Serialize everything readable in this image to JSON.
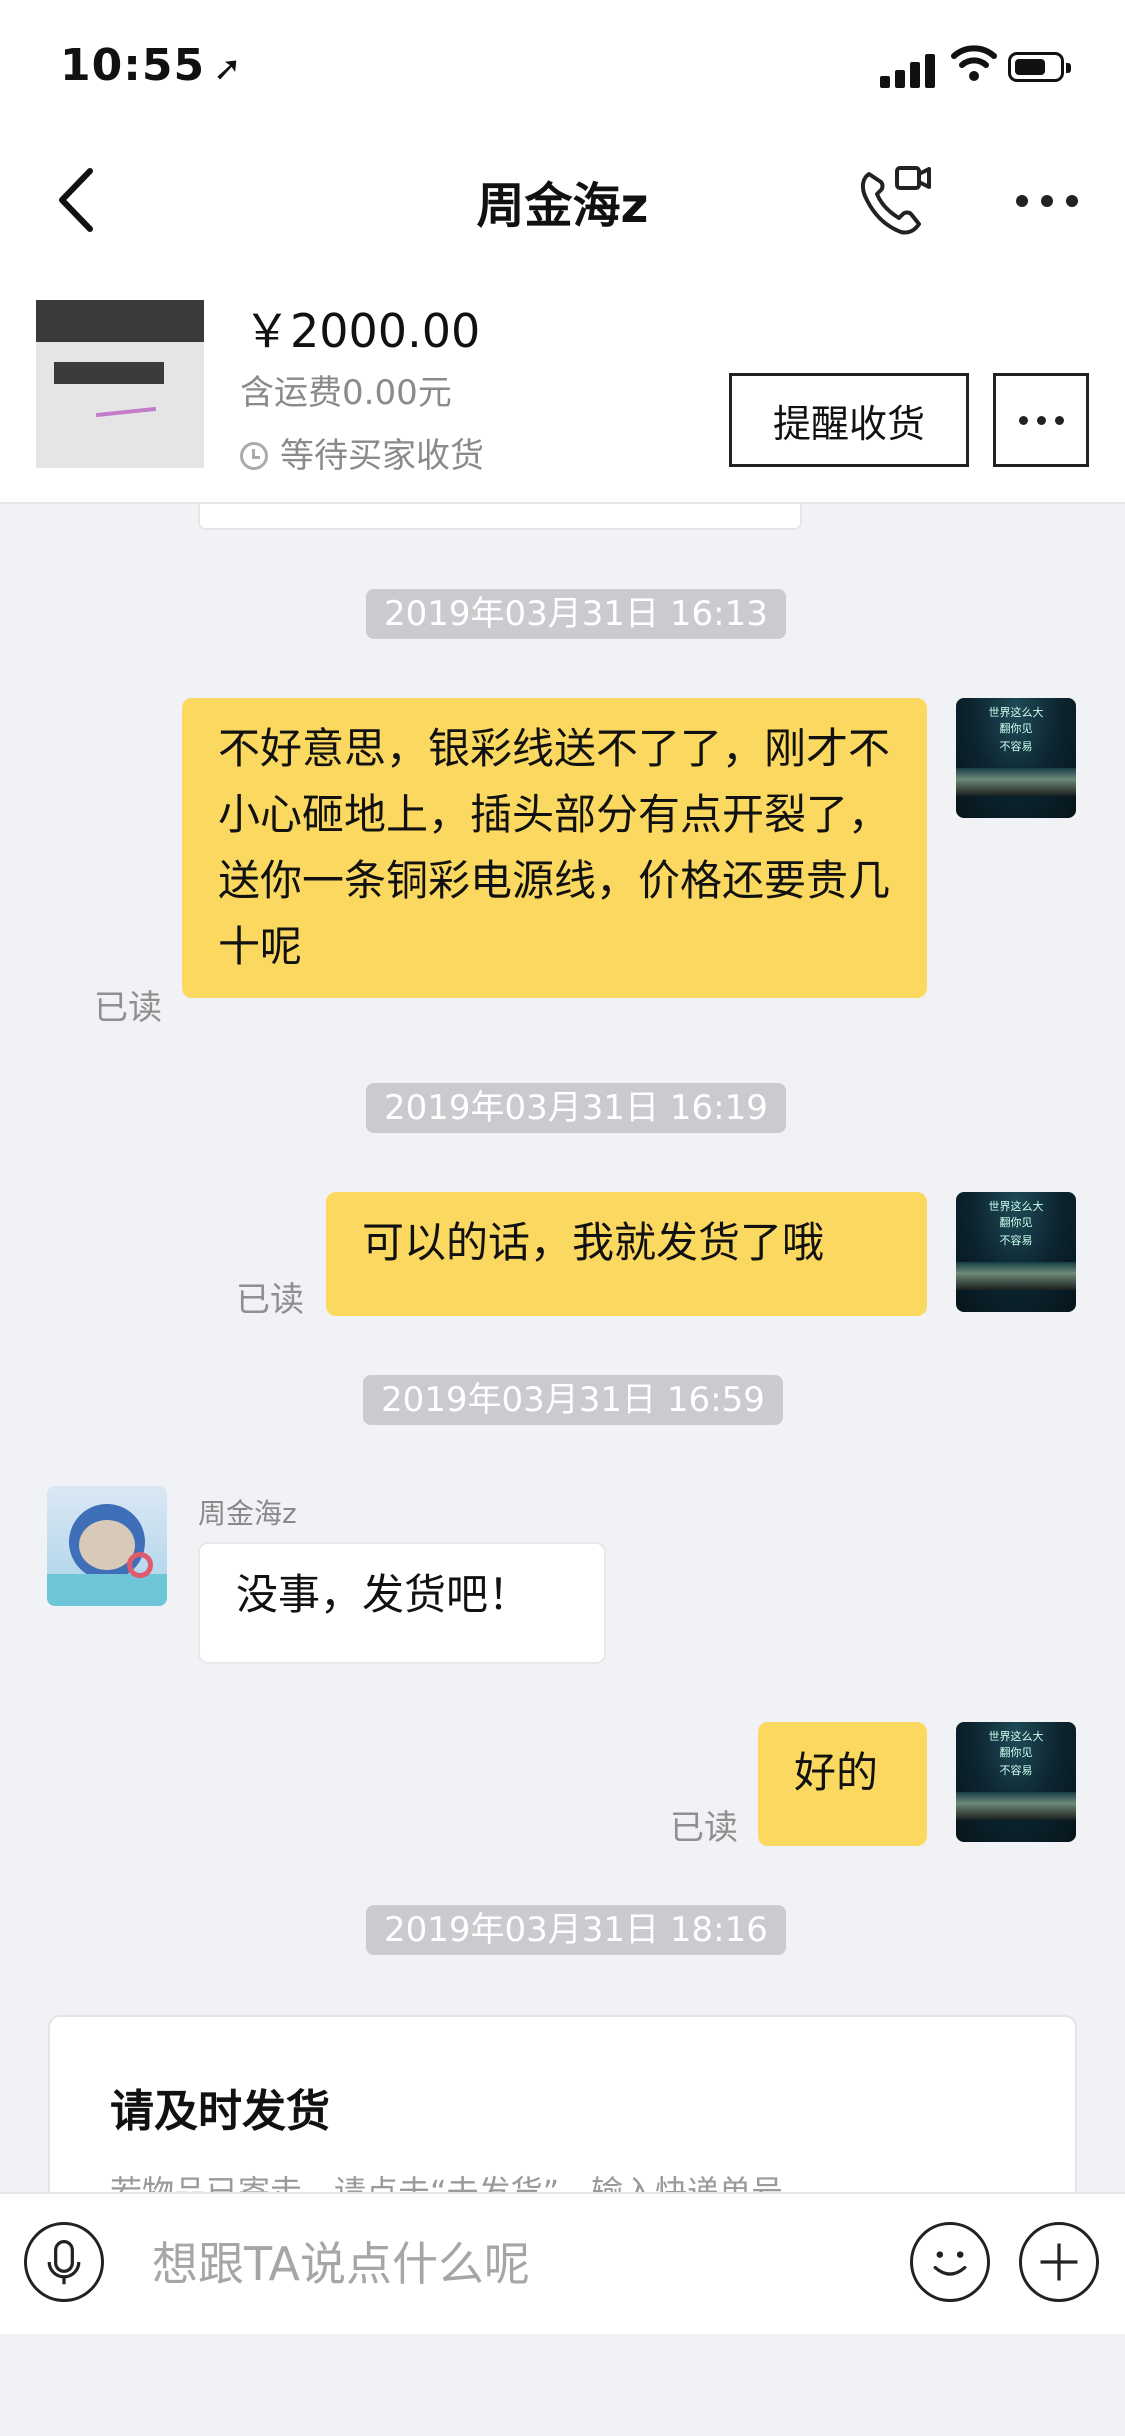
{
  "status_bar": {
    "time": "10:55",
    "location_icon": "location-arrow-icon"
  },
  "header": {
    "title": "周金海z",
    "back_icon": "chevron-left-icon",
    "call_icon": "video-call-icon",
    "more_icon": "more-horizontal-icon"
  },
  "product": {
    "price": "￥2000.00",
    "shipping": "含运费0.00元",
    "status": "等待买家收货",
    "remind_button": "提醒收货"
  },
  "messages": {
    "ts1": "2019年03月31日  16:13",
    "m1_read": "已读",
    "m1_text": "不好意思，银彩线送不了了，刚才不小心砸地上，插头部分有点开裂了，送你一条铜彩电源线，价格还要贵几十呢",
    "ts2": "2019年03月31日  16:19",
    "m2_read": "已读",
    "m2_text": "可以的话，我就发货了哦",
    "ts3": "2019年03月31日  16:59",
    "m3_sender": "周金海z",
    "m3_text": "没事，发货吧！",
    "m4_read": "已读",
    "m4_text": "好的",
    "ts4": "2019年03月31日  18:16"
  },
  "system_card": {
    "title": "请及时发货",
    "description": "若物品已寄走，请点击“去发货”，输入快递单号"
  },
  "input_bar": {
    "placeholder": "想跟TA说点什么呢",
    "mic_icon": "microphone-icon",
    "emoji_icon": "smile-icon",
    "plus_icon": "plus-icon"
  },
  "colors": {
    "bubble_self": "#fbd960",
    "background": "#f1f2f5",
    "timestamp_bg": "#cbcbcf"
  }
}
